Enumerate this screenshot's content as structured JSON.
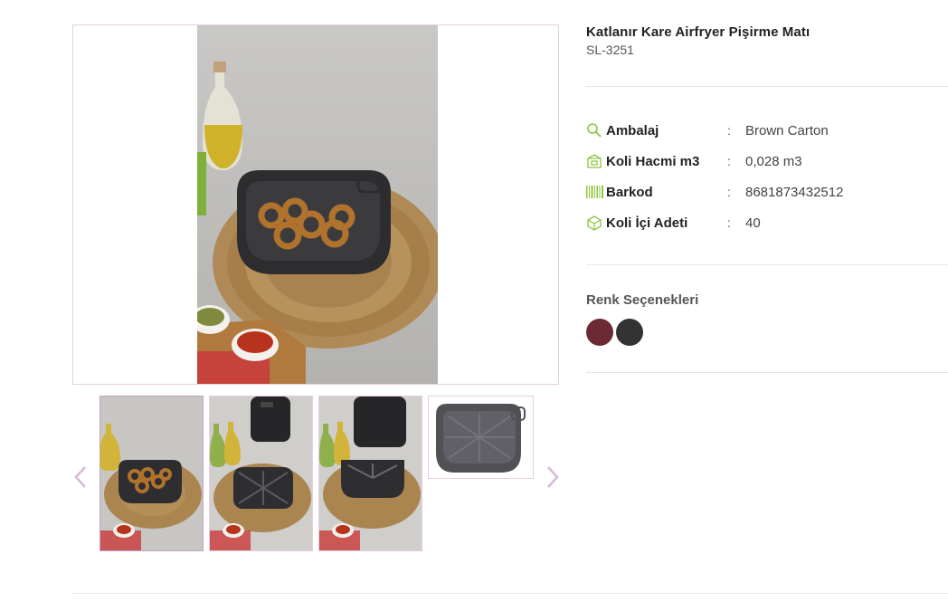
{
  "product": {
    "title": "Katlanır Kare Airfryer Pişirme Matı",
    "sku": "SL-3251"
  },
  "gallery": {
    "main_image": "product-photo-airfryer-mat-with-simit",
    "thumbnails": [
      "thumb-mat-with-simit",
      "thumb-mat-with-airfryer",
      "thumb-mat-with-airfryer-2",
      "thumb-mat-product-only"
    ],
    "prev_icon": "chevron-left-icon",
    "next_icon": "chevron-right-icon"
  },
  "specs": [
    {
      "icon": "search-icon",
      "label": "Ambalaj",
      "colon": ":",
      "value": "Brown Carton"
    },
    {
      "icon": "box-icon",
      "label": "Koli Hacmi m3",
      "colon": ":",
      "value": "0,028 m3"
    },
    {
      "icon": "barcode-icon",
      "label": "Barkod",
      "colon": ":",
      "value": "8681873432512"
    },
    {
      "icon": "package-icon",
      "label": "Koli İçi Adeti",
      "colon": ":",
      "value": "40"
    }
  ],
  "colors": {
    "title": "Renk Seçenekleri",
    "options": [
      "#6b2a34",
      "#333333"
    ]
  },
  "theme": {
    "accent": "#8dc63f",
    "border": "#e3cfe0",
    "arrow": "#d9b8d6"
  }
}
